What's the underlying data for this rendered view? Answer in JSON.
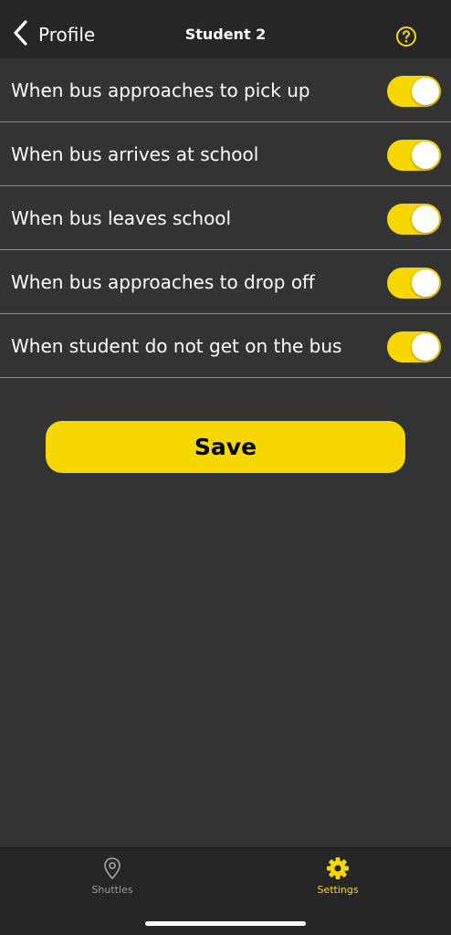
{
  "colors": {
    "accent": "#F7D700",
    "background": "#333333",
    "header_bg": "#262626",
    "divider": "#8C8C8C",
    "inactive_tab": "#9A9A9A"
  },
  "header": {
    "back_label": "Profile",
    "back_icon": "chevron-left-icon",
    "title": "Student 2",
    "help_icon": "question-circle-icon"
  },
  "settings": {
    "items": [
      {
        "label": "When bus approaches to pick up",
        "enabled": true
      },
      {
        "label": "When bus arrives at school",
        "enabled": true
      },
      {
        "label": "When bus leaves school",
        "enabled": true
      },
      {
        "label": "When bus approaches to drop off",
        "enabled": true
      },
      {
        "label": "When student do not get on the bus",
        "enabled": true
      }
    ]
  },
  "actions": {
    "save_label": "Save"
  },
  "tab_bar": {
    "tabs": [
      {
        "label": "Shuttles",
        "icon": "map-pin-icon",
        "active": false
      },
      {
        "label": "Settings",
        "icon": "gear-icon",
        "active": true
      }
    ]
  }
}
